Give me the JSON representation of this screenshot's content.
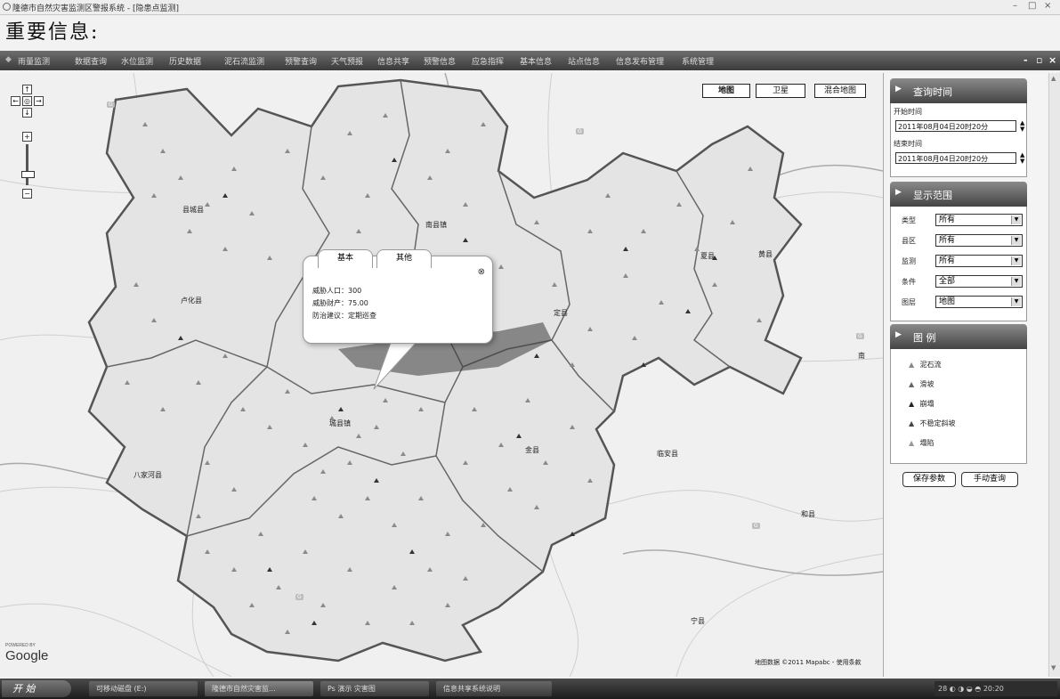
{
  "window": {
    "title": "隆德市自然灾害监测区警报系统 - [隐患点监测]"
  },
  "heading": "重要信息:",
  "menu": [
    "雨量监测",
    "数据查询",
    "水位监测",
    "历史数据",
    "泥石流监测",
    "预警查询",
    "天气预报",
    "信息共享",
    "预警信息",
    "应急指挥",
    "基本信息",
    "站点信息",
    "信息发布管理",
    "系统管理"
  ],
  "map": {
    "types": [
      "地图",
      "卫星",
      "混合地图"
    ],
    "labels": [
      "县城县",
      "南县镇",
      "卢化县",
      "定县",
      "黄县",
      "八家河县",
      "临安县",
      "宁县",
      "和县",
      "金县",
      "夏县",
      "城县镇",
      "南"
    ],
    "popup": {
      "tabs": [
        "基本",
        "其他"
      ],
      "rows": [
        "威胁人口：300",
        "威胁财产：75.00",
        "防治建议：定期巡查"
      ]
    },
    "google": "Google",
    "powered": "POWERED BY",
    "copyright": "地图数据 ©2011 Mapabc - 使用条款"
  },
  "panel": {
    "time": {
      "title": "查询时间",
      "start_label": "开始时间",
      "start_value": "2011年08月04日20时20分",
      "end_label": "结束时间",
      "end_value": "2011年08月04日20时20分"
    },
    "range": {
      "title": "显示范围",
      "fields": [
        {
          "label": "类型",
          "value": "所有"
        },
        {
          "label": "县区",
          "value": "所有"
        },
        {
          "label": "监测",
          "value": "所有"
        },
        {
          "label": "条件",
          "value": "全部"
        },
        {
          "label": "图层",
          "value": "地图"
        }
      ]
    },
    "legend": {
      "title": "图 例",
      "items": [
        "泥石流",
        "滑坡",
        "崩塌",
        "不稳定斜坡",
        "塌陷"
      ]
    },
    "buttons": [
      "保存参数",
      "手动查询"
    ]
  },
  "taskbar": {
    "start": "开 始",
    "tasks": [
      "可移动磁盘 (E:)",
      "隆德市自然灾害监...",
      "Ps 演示 灾害图",
      "信息共享系统说明"
    ],
    "tray": "28 ◐ ◑ ◒ ◓ 20:20"
  }
}
